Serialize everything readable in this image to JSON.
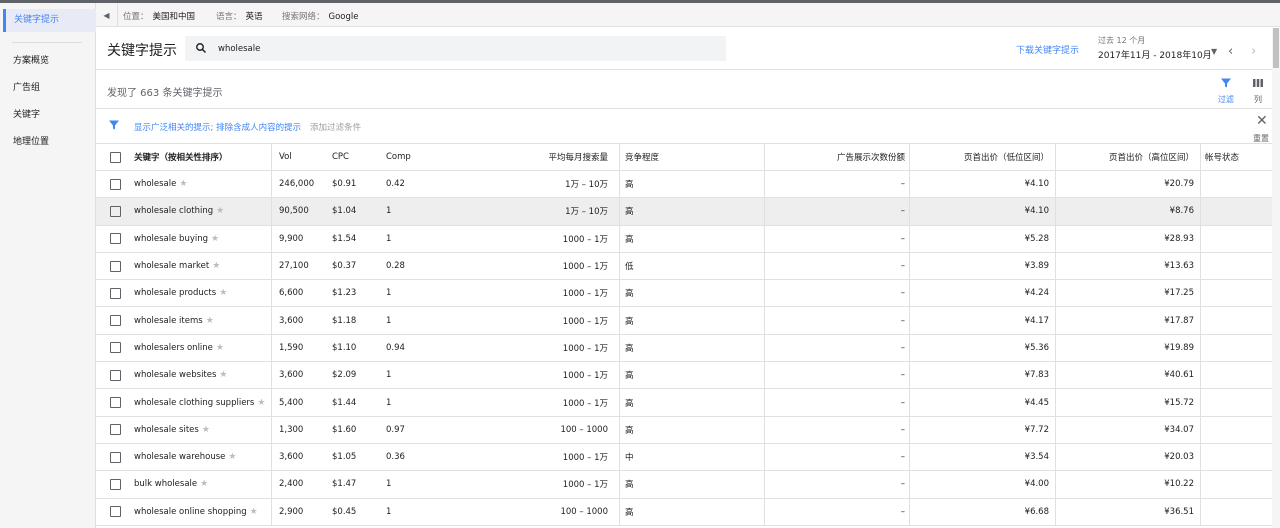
{
  "nav": {
    "active": "关键字提示",
    "items": [
      "方案概览",
      "广告组",
      "关键字",
      "地理位置"
    ]
  },
  "filterbar": {
    "location_label": "位置：",
    "location_value": "美国和中国",
    "language_label": "语言：",
    "language_value": "英语",
    "network_label": "搜索网络：",
    "network_value": "Google"
  },
  "header": {
    "title": "关键字提示",
    "search_value": "wholesale",
    "download_label": "下载关键字提示",
    "date_caption": "过去 12 个月",
    "date_range": "2017年11月 - 2018年10月"
  },
  "summary": {
    "found_text": "发现了 663 条关键字提示",
    "filter_tool_label": "过滤",
    "columns_tool_label": "列"
  },
  "filters": {
    "link_text": "显示广泛相关的提示; 排除含成人内容的提示",
    "add_filter": "添加过滤条件",
    "reset_label": "重置"
  },
  "table": {
    "headers": {
      "keyword": "关键字（按相关性排序）",
      "vol": "Vol",
      "cpc": "CPC",
      "comp": "Comp",
      "avg_monthly": "平均每月搜索量",
      "competition": "竞争程度",
      "impression_share": "广告展示次数份额",
      "bid_low": "页首出价（低位区间）",
      "bid_high": "页首出价（高位区间）",
      "account_status": "帐号状态"
    },
    "rows": [
      {
        "keyword": "wholesale",
        "vol": "246,000",
        "cpc": "$0.91",
        "comp": "0.42",
        "avg": "1万 – 10万",
        "competition": "高",
        "share": "–",
        "low": "¥4.10",
        "high": "¥20.79"
      },
      {
        "keyword": "wholesale clothing",
        "vol": "90,500",
        "cpc": "$1.04",
        "comp": "1",
        "avg": "1万 – 10万",
        "competition": "高",
        "share": "–",
        "low": "¥4.10",
        "high": "¥8.76"
      },
      {
        "keyword": "wholesale buying",
        "vol": "9,900",
        "cpc": "$1.54",
        "comp": "1",
        "avg": "1000 – 1万",
        "competition": "高",
        "share": "–",
        "low": "¥5.28",
        "high": "¥28.93"
      },
      {
        "keyword": "wholesale market",
        "vol": "27,100",
        "cpc": "$0.37",
        "comp": "0.28",
        "avg": "1000 – 1万",
        "competition": "低",
        "share": "–",
        "low": "¥3.89",
        "high": "¥13.63"
      },
      {
        "keyword": "wholesale products",
        "vol": "6,600",
        "cpc": "$1.23",
        "comp": "1",
        "avg": "1000 – 1万",
        "competition": "高",
        "share": "–",
        "low": "¥4.24",
        "high": "¥17.25"
      },
      {
        "keyword": "wholesale items",
        "vol": "3,600",
        "cpc": "$1.18",
        "comp": "1",
        "avg": "1000 – 1万",
        "competition": "高",
        "share": "–",
        "low": "¥4.17",
        "high": "¥17.87"
      },
      {
        "keyword": "wholesalers online",
        "vol": "1,590",
        "cpc": "$1.10",
        "comp": "0.94",
        "avg": "1000 – 1万",
        "competition": "高",
        "share": "–",
        "low": "¥5.36",
        "high": "¥19.89"
      },
      {
        "keyword": "wholesale websites",
        "vol": "3,600",
        "cpc": "$2.09",
        "comp": "1",
        "avg": "1000 – 1万",
        "competition": "高",
        "share": "–",
        "low": "¥7.83",
        "high": "¥40.61"
      },
      {
        "keyword": "wholesale clothing suppliers",
        "vol": "5,400",
        "cpc": "$1.44",
        "comp": "1",
        "avg": "1000 – 1万",
        "competition": "高",
        "share": "–",
        "low": "¥4.45",
        "high": "¥15.72"
      },
      {
        "keyword": "wholesale sites",
        "vol": "1,300",
        "cpc": "$1.60",
        "comp": "0.97",
        "avg": "100 – 1000",
        "competition": "高",
        "share": "–",
        "low": "¥7.72",
        "high": "¥34.07"
      },
      {
        "keyword": "wholesale warehouse",
        "vol": "3,600",
        "cpc": "$1.05",
        "comp": "0.36",
        "avg": "1000 – 1万",
        "competition": "中",
        "share": "–",
        "low": "¥3.54",
        "high": "¥20.03"
      },
      {
        "keyword": "bulk wholesale",
        "vol": "2,400",
        "cpc": "$1.47",
        "comp": "1",
        "avg": "1000 – 1万",
        "competition": "高",
        "share": "–",
        "low": "¥4.00",
        "high": "¥10.22"
      },
      {
        "keyword": "wholesale online shopping",
        "vol": "2,900",
        "cpc": "$0.45",
        "comp": "1",
        "avg": "100 – 1000",
        "competition": "高",
        "share": "–",
        "low": "¥6.68",
        "high": "¥36.51"
      }
    ]
  },
  "colors": {
    "accent": "#4285f4",
    "highlight_row": "#eeeeee",
    "border": "#e0e0e0"
  }
}
